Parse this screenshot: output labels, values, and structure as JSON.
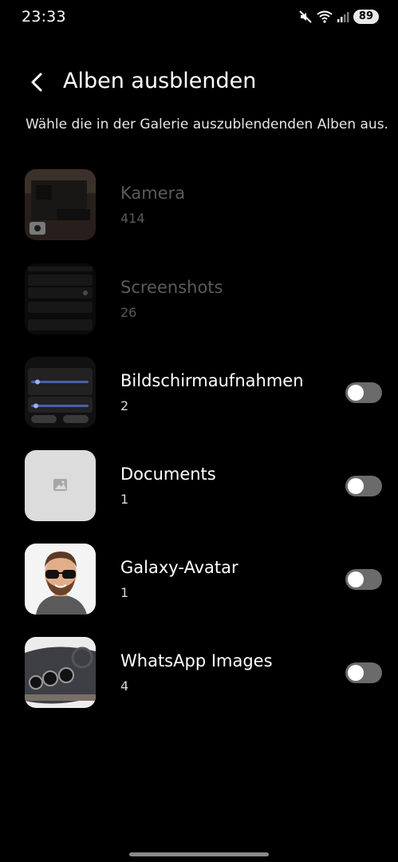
{
  "status": {
    "time": "23:33",
    "battery": "89"
  },
  "header": {
    "title": "Alben ausblenden"
  },
  "subtitle": "Wähle die in der Galerie auszublendenden Alben aus.",
  "albums": [
    {
      "name": "Kamera",
      "count": "414",
      "toggle_state": "unavailable"
    },
    {
      "name": "Screenshots",
      "count": "26",
      "toggle_state": "unavailable"
    },
    {
      "name": "Bildschirmaufnahmen",
      "count": "2",
      "toggle_state": "off"
    },
    {
      "name": "Documents",
      "count": "1",
      "toggle_state": "off"
    },
    {
      "name": "Galaxy-Avatar",
      "count": "1",
      "toggle_state": "off"
    },
    {
      "name": "WhatsApp Images",
      "count": "4",
      "toggle_state": "off"
    }
  ],
  "colors": {
    "background": "#000000",
    "toggle_off": "#6b6b6b",
    "text_dim": "#5a5a5a"
  }
}
